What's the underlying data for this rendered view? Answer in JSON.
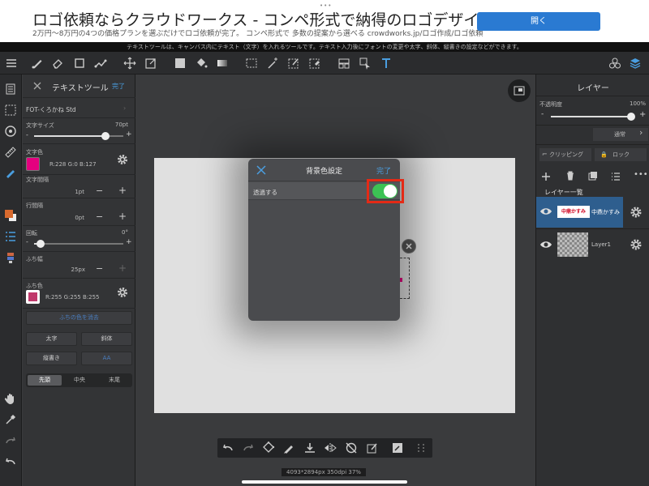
{
  "ad": {
    "title": "ロゴ依頼ならクラウドワークス - コンペ形式で納得のロゴデザイン",
    "subtitle": "2万円〜8万円の4つの価格プランを選ぶだけでロゴ依頼が完了。 コンペ形式で 多数の提案から選べる crowdworks.jp/ロゴ作成/ロゴ依頼",
    "open_label": "開く"
  },
  "hint": "テキストツールは、キャンバス内にテキスト（文字）を入れるツールです。テキスト入力後にフォントの変更や太字、斜体、縦書きの設定などができます。",
  "text_panel": {
    "title": "テキストツール",
    "done": "完了",
    "font": "FOT-くろかね Std",
    "size_label": "文字サイズ",
    "size_value": "70pt",
    "color_label": "文字色",
    "color_value": "R:228 G:0 B:127",
    "char_spacing_label": "文字間隔",
    "char_spacing_value": "1pt",
    "line_spacing_label": "行間隔",
    "line_spacing_value": "0pt",
    "rotate_label": "回転",
    "rotate_value": "0°",
    "border_width_label": "ふち幅",
    "border_width_value": "25px",
    "border_color_label": "ふち色",
    "border_color_value": "R:255 G:255 B:255",
    "remove_border": "ふちの色を消去",
    "bold": "太字",
    "italic": "斜体",
    "vertical": "縦書き",
    "aa": "AA",
    "align": [
      "先頭",
      "中央",
      "末尾"
    ]
  },
  "dialog": {
    "title": "背景色設定",
    "done": "完了",
    "transparent_label": "透過する",
    "transparent_on": true
  },
  "layers": {
    "title": "レイヤー",
    "opacity_label": "不透明度",
    "opacity_value": "100%",
    "blend_mode": "通常",
    "clipping": "クリッピング",
    "lock": "ロック",
    "list_label": "レイヤー一覧",
    "items": [
      {
        "name": "中鼎かすみ",
        "thumb_text": "中鼎かすみ",
        "selected": true
      },
      {
        "name": "Layer1",
        "thumb_text": "",
        "selected": false
      }
    ]
  },
  "status": "4093*2894px 350dpi 37%",
  "colors": {
    "text_color": "#e4007f",
    "toggle_on": "#3cc254",
    "highlight": "#e42a16",
    "accent": "#4a9ee0",
    "ad_button": "#2a7ad2"
  }
}
